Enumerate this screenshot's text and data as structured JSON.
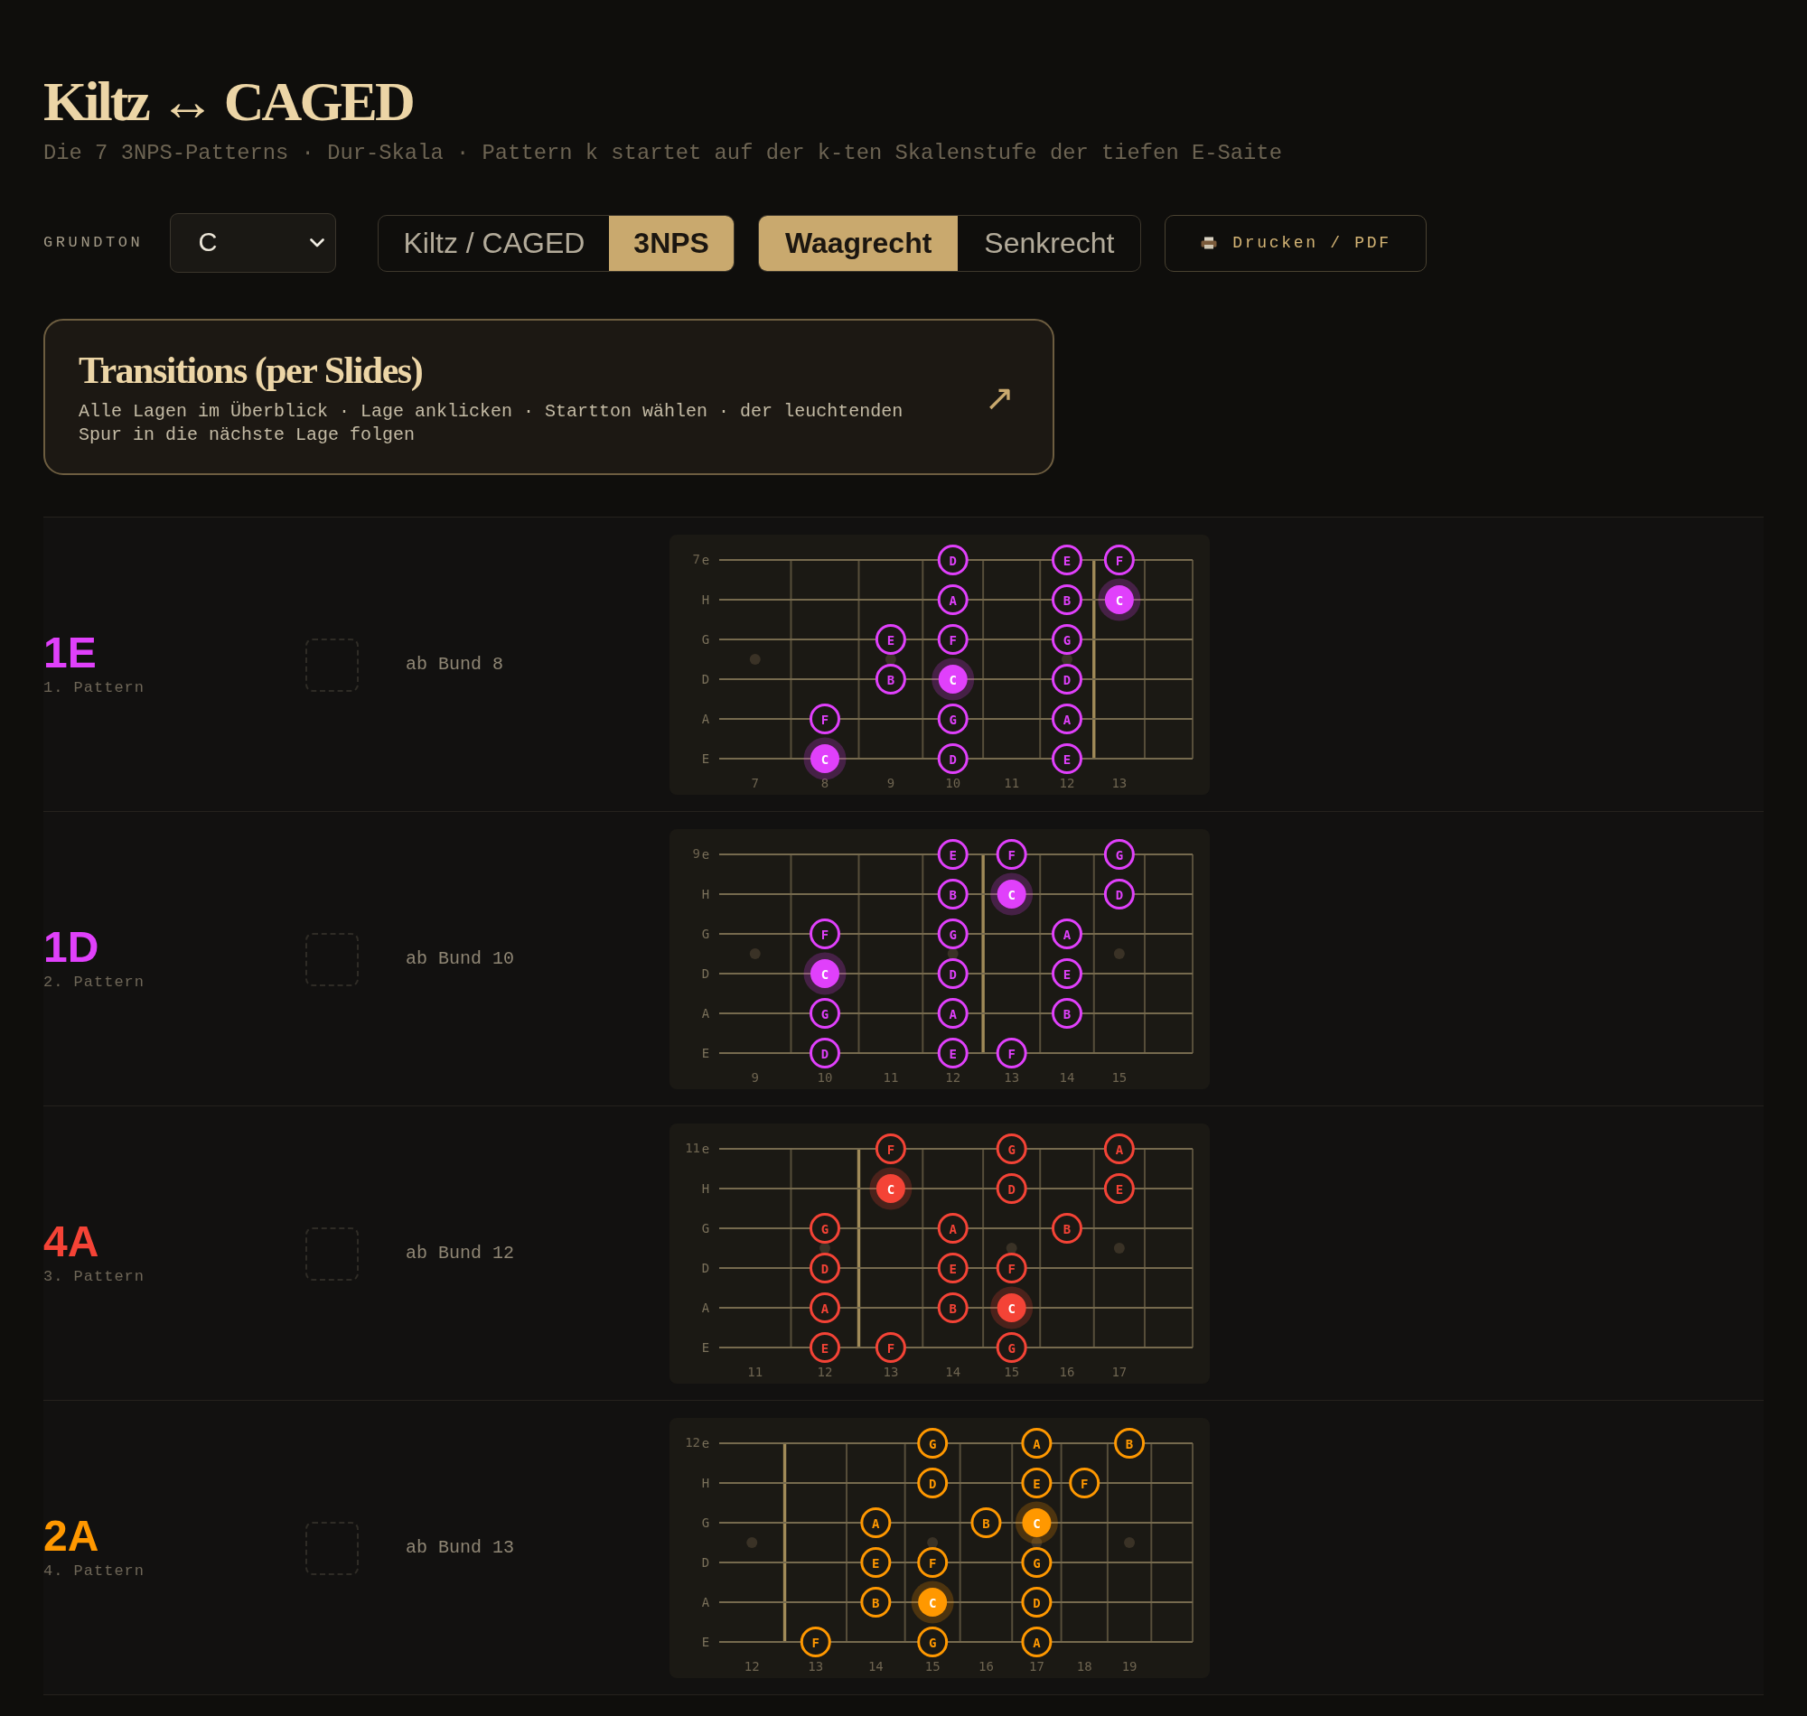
{
  "header": {
    "title": "Kiltz ↔ CAGED",
    "subtitle": "Die 7 3NPS-Patterns · Dur-Skala · Pattern k startet auf der k-ten Skalenstufe der tiefen E-Saite"
  },
  "controls": {
    "root_label": "GRUNDTON",
    "root_select": {
      "value": "C"
    },
    "view_modes": [
      {
        "label": "Kiltz / CAGED",
        "selected": false
      },
      {
        "label": "3NPS",
        "selected": true
      }
    ],
    "orientations": [
      {
        "label": "Waagrecht",
        "selected": true
      },
      {
        "label": "Senkrecht",
        "selected": false
      }
    ],
    "print_button": {
      "label": "Drucken / PDF"
    }
  },
  "transitions_card": {
    "title": "Transitions (per Slides)",
    "description": "Alle Lagen im Überblick · Lage anklicken · Startton wählen · der leuchtenden Spur in die nächste Lage folgen",
    "arrow": "↗"
  },
  "patterns": [
    {
      "label": "1E",
      "color": "#e040fb",
      "caption": "1. Pattern",
      "start": "ab Bund 8",
      "fretboard": {
        "corner_number": "7",
        "frets": [
          {
            "label": "7",
            "inlay": true,
            "octave": false
          },
          {
            "label": "8",
            "inlay": false,
            "octave": false
          },
          {
            "label": "9",
            "inlay": true,
            "octave": false
          },
          {
            "label": "10",
            "inlay": false,
            "octave": false
          },
          {
            "label": "11",
            "inlay": false,
            "octave": false
          },
          {
            "label": "12",
            "inlay": true,
            "octave": true
          },
          {
            "label": "13",
            "inlay": false,
            "octave": false
          }
        ],
        "strings": [
          {
            "label": "e",
            "cells": [
              null,
              null,
              null,
              {
                "note": "D",
                "root": false
              },
              null,
              {
                "note": "E",
                "root": false
              },
              {
                "note": "F",
                "root": false
              }
            ]
          },
          {
            "label": "H",
            "cells": [
              null,
              null,
              null,
              {
                "note": "A",
                "root": false
              },
              null,
              {
                "note": "B",
                "root": false
              },
              {
                "note": "C",
                "root": true
              }
            ]
          },
          {
            "label": "G",
            "cells": [
              null,
              null,
              {
                "note": "E",
                "root": false
              },
              {
                "note": "F",
                "root": false
              },
              null,
              {
                "note": "G",
                "root": false
              },
              null
            ]
          },
          {
            "label": "D",
            "cells": [
              null,
              null,
              {
                "note": "B",
                "root": false
              },
              {
                "note": "C",
                "root": true
              },
              null,
              {
                "note": "D",
                "root": false
              },
              null
            ]
          },
          {
            "label": "A",
            "cells": [
              null,
              {
                "note": "F",
                "root": false
              },
              null,
              {
                "note": "G",
                "root": false
              },
              null,
              {
                "note": "A",
                "root": false
              },
              null
            ]
          },
          {
            "label": "E",
            "cells": [
              null,
              {
                "note": "C",
                "root": true
              },
              null,
              {
                "note": "D",
                "root": false
              },
              null,
              {
                "note": "E",
                "root": false
              },
              null
            ]
          }
        ]
      }
    },
    {
      "label": "1D",
      "color": "#e040fb",
      "caption": "2. Pattern",
      "start": "ab Bund 10",
      "fretboard": {
        "corner_number": "9",
        "frets": [
          {
            "label": "9",
            "inlay": true,
            "octave": false
          },
          {
            "label": "10",
            "inlay": false,
            "octave": false
          },
          {
            "label": "11",
            "inlay": false,
            "octave": false
          },
          {
            "label": "12",
            "inlay": true,
            "octave": true
          },
          {
            "label": "13",
            "inlay": false,
            "octave": false
          },
          {
            "label": "14",
            "inlay": false,
            "octave": false
          },
          {
            "label": "15",
            "inlay": true,
            "octave": false
          }
        ],
        "strings": [
          {
            "label": "e",
            "cells": [
              null,
              null,
              null,
              {
                "note": "E",
                "root": false
              },
              {
                "note": "F",
                "root": false
              },
              null,
              {
                "note": "G",
                "root": false
              }
            ]
          },
          {
            "label": "H",
            "cells": [
              null,
              null,
              null,
              {
                "note": "B",
                "root": false
              },
              {
                "note": "C",
                "root": true
              },
              null,
              {
                "note": "D",
                "root": false
              }
            ]
          },
          {
            "label": "G",
            "cells": [
              null,
              {
                "note": "F",
                "root": false
              },
              null,
              {
                "note": "G",
                "root": false
              },
              null,
              {
                "note": "A",
                "root": false
              },
              null
            ]
          },
          {
            "label": "D",
            "cells": [
              null,
              {
                "note": "C",
                "root": true
              },
              null,
              {
                "note": "D",
                "root": false
              },
              null,
              {
                "note": "E",
                "root": false
              },
              null
            ]
          },
          {
            "label": "A",
            "cells": [
              null,
              {
                "note": "G",
                "root": false
              },
              null,
              {
                "note": "A",
                "root": false
              },
              null,
              {
                "note": "B",
                "root": false
              },
              null
            ]
          },
          {
            "label": "E",
            "cells": [
              null,
              {
                "note": "D",
                "root": false
              },
              null,
              {
                "note": "E",
                "root": false
              },
              {
                "note": "F",
                "root": false
              },
              null,
              null
            ]
          }
        ]
      }
    },
    {
      "label": "4A",
      "color": "#f44336",
      "caption": "3. Pattern",
      "start": "ab Bund 12",
      "fretboard": {
        "corner_number": "11",
        "frets": [
          {
            "label": "11",
            "inlay": false,
            "octave": false
          },
          {
            "label": "12",
            "inlay": true,
            "octave": true
          },
          {
            "label": "13",
            "inlay": false,
            "octave": false
          },
          {
            "label": "14",
            "inlay": false,
            "octave": false
          },
          {
            "label": "15",
            "inlay": true,
            "octave": false
          },
          {
            "label": "16",
            "inlay": false,
            "octave": false
          },
          {
            "label": "17",
            "inlay": true,
            "octave": false
          }
        ],
        "strings": [
          {
            "label": "e",
            "cells": [
              null,
              null,
              {
                "note": "F",
                "root": false
              },
              null,
              {
                "note": "G",
                "root": false
              },
              null,
              {
                "note": "A",
                "root": false
              }
            ]
          },
          {
            "label": "H",
            "cells": [
              null,
              null,
              {
                "note": "C",
                "root": true
              },
              null,
              {
                "note": "D",
                "root": false
              },
              null,
              {
                "note": "E",
                "root": false
              }
            ]
          },
          {
            "label": "G",
            "cells": [
              null,
              {
                "note": "G",
                "root": false
              },
              null,
              {
                "note": "A",
                "root": false
              },
              null,
              {
                "note": "B",
                "root": false
              },
              null
            ]
          },
          {
            "label": "D",
            "cells": [
              null,
              {
                "note": "D",
                "root": false
              },
              null,
              {
                "note": "E",
                "root": false
              },
              {
                "note": "F",
                "root": false
              },
              null,
              null
            ]
          },
          {
            "label": "A",
            "cells": [
              null,
              {
                "note": "A",
                "root": false
              },
              null,
              {
                "note": "B",
                "root": false
              },
              {
                "note": "C",
                "root": true
              },
              null,
              null
            ]
          },
          {
            "label": "E",
            "cells": [
              null,
              {
                "note": "E",
                "root": false
              },
              {
                "note": "F",
                "root": false
              },
              null,
              {
                "note": "G",
                "root": false
              },
              null,
              null
            ]
          }
        ]
      }
    },
    {
      "label": "2A",
      "color": "#ff9800",
      "caption": "4. Pattern",
      "start": "ab Bund 13",
      "fretboard": {
        "corner_number": "12",
        "frets": [
          {
            "label": "12",
            "inlay": true,
            "octave": true
          },
          {
            "label": "13",
            "inlay": false,
            "octave": false
          },
          {
            "label": "14",
            "inlay": false,
            "octave": false
          },
          {
            "label": "15",
            "inlay": true,
            "octave": false
          },
          {
            "label": "16",
            "inlay": false,
            "octave": false
          },
          {
            "label": "17",
            "inlay": true,
            "octave": false
          },
          {
            "label": "18",
            "inlay": false,
            "octave": false
          },
          {
            "label": "19",
            "inlay": true,
            "octave": false
          }
        ],
        "strings": [
          {
            "label": "e",
            "cells": [
              null,
              null,
              null,
              {
                "note": "G",
                "root": false
              },
              null,
              {
                "note": "A",
                "root": false
              },
              null,
              {
                "note": "B",
                "root": false
              }
            ]
          },
          {
            "label": "H",
            "cells": [
              null,
              null,
              null,
              {
                "note": "D",
                "root": false
              },
              null,
              {
                "note": "E",
                "root": false
              },
              {
                "note": "F",
                "root": false
              },
              null
            ]
          },
          {
            "label": "G",
            "cells": [
              null,
              null,
              {
                "note": "A",
                "root": false
              },
              null,
              {
                "note": "B",
                "root": false
              },
              {
                "note": "C",
                "root": true
              },
              null,
              null
            ]
          },
          {
            "label": "D",
            "cells": [
              null,
              null,
              {
                "note": "E",
                "root": false
              },
              {
                "note": "F",
                "root": false
              },
              null,
              {
                "note": "G",
                "root": false
              },
              null,
              null
            ]
          },
          {
            "label": "A",
            "cells": [
              null,
              null,
              {
                "note": "B",
                "root": false
              },
              {
                "note": "C",
                "root": true
              },
              null,
              {
                "note": "D",
                "root": false
              },
              null,
              null
            ]
          },
          {
            "label": "E",
            "cells": [
              null,
              {
                "note": "F",
                "root": false
              },
              null,
              {
                "note": "G",
                "root": false
              },
              null,
              {
                "note": "A",
                "root": false
              },
              null,
              null
            ]
          }
        ]
      }
    }
  ]
}
